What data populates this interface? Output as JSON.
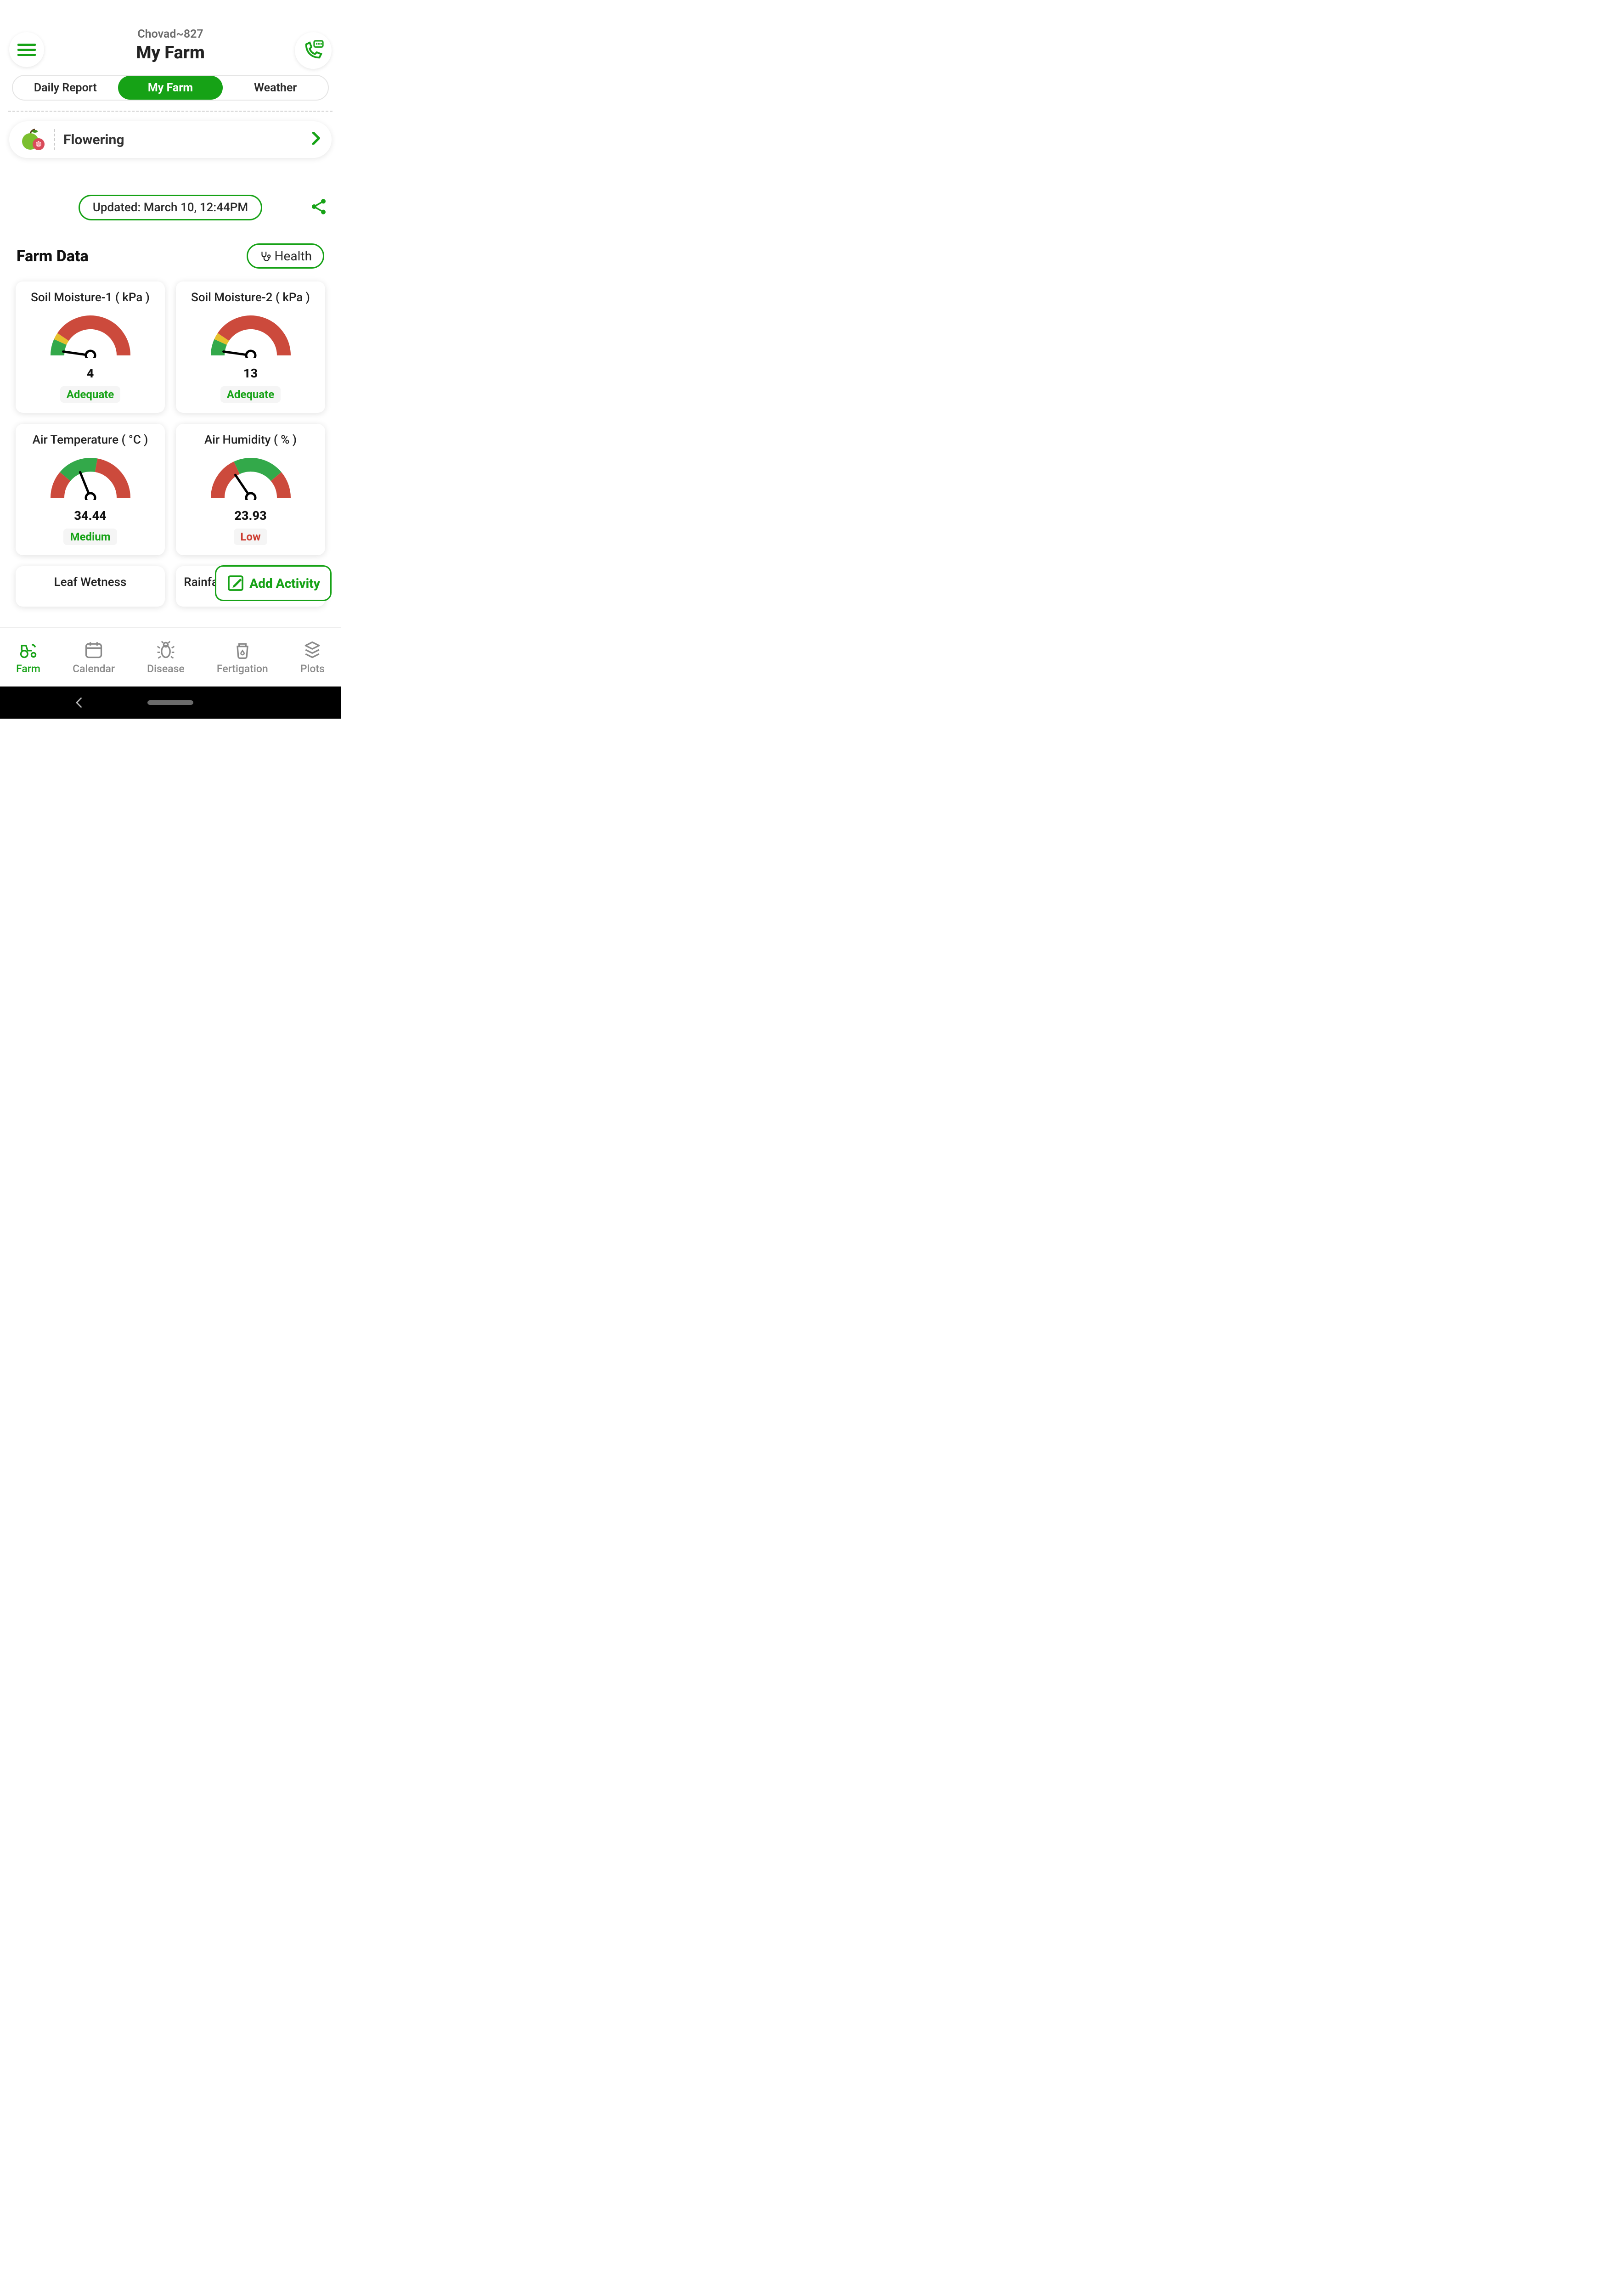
{
  "header": {
    "sub": "Chovad~827",
    "title": "My Farm"
  },
  "tabs": [
    "Daily Report",
    "My Farm",
    "Weather"
  ],
  "active_tab": 1,
  "crop": {
    "stage": "Flowering"
  },
  "updated": "Updated: March 10, 12:44PM",
  "section_title": "Farm Data",
  "health_label": "Health",
  "add_activity": "Add Activity",
  "cards": [
    {
      "title": "Soil Moisture-1 ( kPa )",
      "value": "4",
      "status": "Adequate",
      "status_kind": "green",
      "gauge": "g1"
    },
    {
      "title": "Soil Moisture-2 ( kPa )",
      "value": "13",
      "status": "Adequate",
      "status_kind": "green",
      "gauge": "g1"
    },
    {
      "title": "Air Temperature ( °C )",
      "value": "34.44",
      "status": "Medium",
      "status_kind": "green",
      "gauge": "g2"
    },
    {
      "title": "Air Humidity ( % )",
      "value": "23.93",
      "status": "Low",
      "status_kind": "red",
      "gauge": "g3"
    },
    {
      "title": "Leaf Wetness",
      "value": "",
      "status": "",
      "status_kind": "",
      "gauge": ""
    },
    {
      "title": "Rainfall Last Hour ( mm )",
      "value": "",
      "status": "",
      "status_kind": "",
      "gauge": ""
    }
  ],
  "bottom_nav": [
    "Farm",
    "Calendar",
    "Disease",
    "Fertigation",
    "Plots"
  ],
  "colors": {
    "primary": "#16a216",
    "red": "#cc3a2e"
  }
}
